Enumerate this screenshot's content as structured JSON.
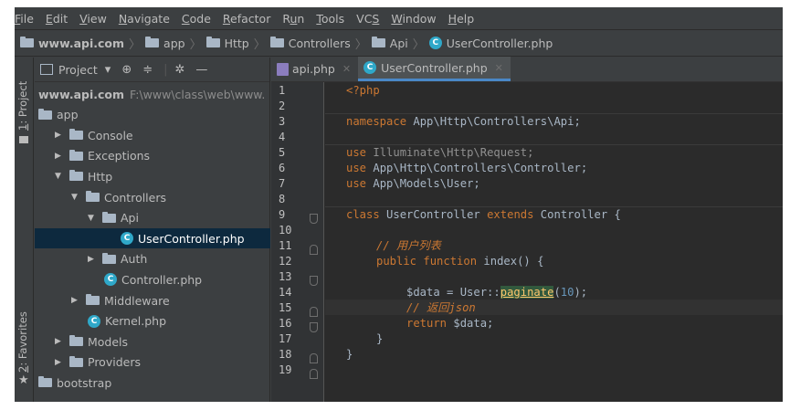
{
  "menu": [
    {
      "mn": "F",
      "rest": "ile"
    },
    {
      "mn": "E",
      "rest": "dit"
    },
    {
      "mn": "V",
      "rest": "iew"
    },
    {
      "mn": "N",
      "rest": "avigate"
    },
    {
      "mn": "C",
      "rest": "ode"
    },
    {
      "mn": "R",
      "rest": "efactor"
    },
    {
      "pre": "R",
      "mn": "u",
      "rest": "n"
    },
    {
      "mn": "T",
      "rest": "ools"
    },
    {
      "pre": "VC",
      "mn": "S",
      "rest": ""
    },
    {
      "mn": "W",
      "rest": "indow"
    },
    {
      "mn": "H",
      "rest": "elp"
    }
  ],
  "breadcrumb": {
    "root": "www.api.com",
    "items": [
      "app",
      "Http",
      "Controllers",
      "Api"
    ],
    "file": "UserController.php"
  },
  "stripe": {
    "project_num": "1",
    "project_label": ": Project",
    "favorites_num": "2",
    "favorites_label": ": Favorites"
  },
  "project_panel": {
    "title": "Project",
    "dropdown_icon": "chevron-down-icon",
    "tree": [
      {
        "label": "www.api.com",
        "path": "F:\\www\\class\\web\\www.",
        "type": "root",
        "indent": 0
      },
      {
        "label": "app",
        "type": "folder",
        "indent": 0
      },
      {
        "label": "Console",
        "type": "folder",
        "arrow": "▶",
        "indent": 1
      },
      {
        "label": "Exceptions",
        "type": "folder",
        "arrow": "▶",
        "indent": 1
      },
      {
        "label": "Http",
        "type": "folder",
        "arrow": "▼",
        "indent": 1
      },
      {
        "label": "Controllers",
        "type": "folder",
        "arrow": "▼",
        "indent": 2
      },
      {
        "label": "Api",
        "type": "folder",
        "arrow": "▼",
        "indent": 3
      },
      {
        "label": "UserController.php",
        "type": "class",
        "indent": 5,
        "selected": true
      },
      {
        "label": "Auth",
        "type": "folder",
        "arrow": "▶",
        "indent": 3
      },
      {
        "label": "Controller.php",
        "type": "class",
        "indent": 4
      },
      {
        "label": "Middleware",
        "type": "folder",
        "arrow": "▶",
        "indent": 2
      },
      {
        "label": "Kernel.php",
        "type": "class",
        "indent": 3
      },
      {
        "label": "Models",
        "type": "folder",
        "arrow": "▶",
        "indent": 1
      },
      {
        "label": "Providers",
        "type": "folder",
        "arrow": "▶",
        "indent": 1
      },
      {
        "label": "bootstrap",
        "type": "folder",
        "indent": 0
      }
    ]
  },
  "tabs": [
    {
      "label": "api.php",
      "icon": "php-file-icon",
      "active": false
    },
    {
      "label": "UserController.php",
      "icon": "class-icon",
      "active": true
    }
  ],
  "code": {
    "lines": [
      "1",
      "2",
      "3",
      "4",
      "5",
      "6",
      "7",
      "8",
      "9",
      "10",
      "11",
      "12",
      "13",
      "14",
      "15",
      "16",
      "17",
      "18",
      "19"
    ],
    "current_line": 15,
    "l1": "<?php",
    "l3_kw": "namespace",
    "l3_rest": " App\\Http\\Controllers\\Api;",
    "l5_kw": "use",
    "l5_rest": " Illuminate\\Http\\Request;",
    "l6_kw": "use",
    "l6_rest": " App\\Http\\Controllers\\Controller;",
    "l7_kw": "use",
    "l7_rest": " App\\Models\\User;",
    "l9_kw": "class",
    "l9_name": " UserController ",
    "l9_kw2": "extends",
    "l9_rest": " Controller {",
    "l11_cm": "// 用户列表",
    "l12_kw": "public function",
    "l12_rest": " index() {",
    "l14_a": "$data = User::",
    "l14_method": "paginate",
    "l14_b": "(",
    "l14_num": "10",
    "l14_c": ");",
    "l15_cm": "// 返回",
    "l15_cm2": "json",
    "l16_kw": "return",
    "l16_rest": " $data;",
    "l17": "}",
    "l18": "}"
  },
  "colors": {
    "background": "#2b2b2b",
    "keyword": "#cc7832",
    "text": "#a9b7c6",
    "number": "#6897bb",
    "selection": "#0d293e"
  }
}
